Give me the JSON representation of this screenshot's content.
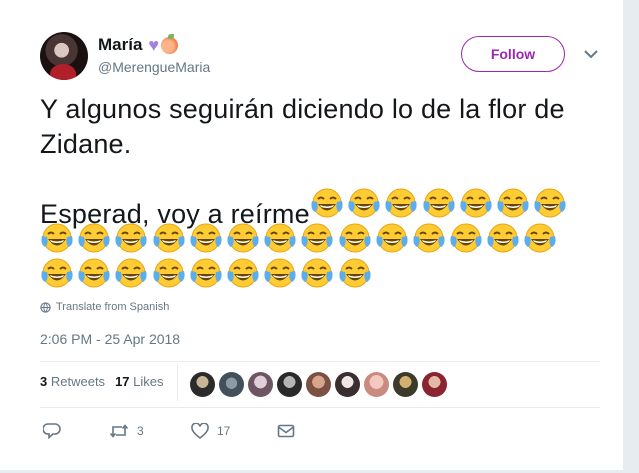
{
  "author": {
    "display_name": "María",
    "handle": "@MerengueMaria",
    "emoji_icons": [
      "purple-heart-icon",
      "peach-icon"
    ]
  },
  "follow_button": {
    "label": "Follow",
    "color": "#9c27b0"
  },
  "tweet": {
    "text": "Y algunos seguirán diciendo lo de la flor de Zidane.\n\nEsperad, voy a reírme",
    "emoji": "face-with-tears-of-joy-icon",
    "emoji_count": 30,
    "translate_label": "Translate from Spanish",
    "timestamp": "2:06 PM - 25 Apr 2018"
  },
  "stats": {
    "retweets_count": "3",
    "retweets_label": "Retweets",
    "likes_count": "17",
    "likes_label": "Likes",
    "liker_avatar_count": 9
  },
  "actions": {
    "reply_icon": "reply-icon",
    "retweet_count": "3",
    "like_count": "17",
    "dm_icon": "envelope-icon"
  },
  "colors": {
    "accent": "#9c27b0",
    "secondary_text": "#657786",
    "primary_text": "#14171a",
    "background": "#e6ecf0"
  }
}
